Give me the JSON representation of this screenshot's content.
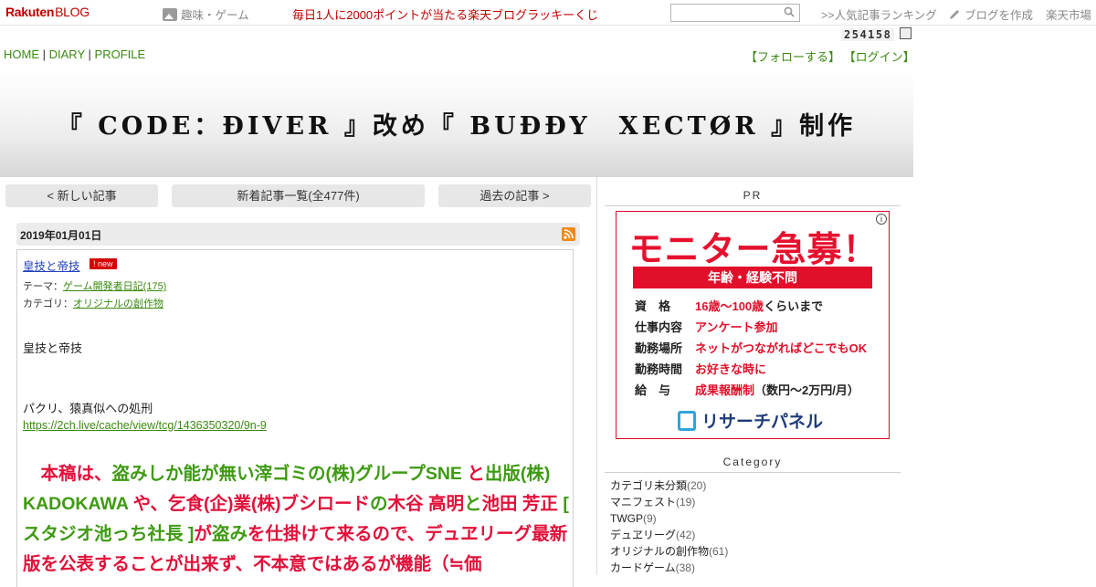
{
  "topbar": {
    "logo_main": "Rakuten",
    "logo_sub": "BLOG",
    "topic": "趣味・ゲーム",
    "lottery": "毎日1人に2000ポイントが当たる楽天ブログラッキーくじ",
    "search_placeholder": "",
    "ranking": ">>人気記事ランキング",
    "write": "ブログを作成",
    "market": "楽天市場"
  },
  "counter": "254158",
  "nav": {
    "home": "HOME",
    "sep1": "|",
    "diary": "DIARY",
    "sep2": "|",
    "profile": "PROFILE"
  },
  "follow": {
    "follow": "【フォローする】",
    "login": "【ログイン】"
  },
  "header": {
    "title": "『 CODE：ÐIVER 』改め『 BUÐÐY　XECTØR 』制作"
  },
  "pager": {
    "newer": "< 新しい記事",
    "list": "新着記事一覧(全477件)",
    "older": "過去の記事 >"
  },
  "entry": {
    "date": "2019年01月01日",
    "title": "皇技と帝技",
    "badge": "new",
    "theme_label": "テーマ：",
    "theme": "ゲーム開発者日記(175)",
    "category_label": "カテゴリ：",
    "category": "オリジナルの創作物",
    "line1": "皇技と帝技",
    "line2": "パクリ、猿真似への処刑",
    "link": "https://2ch.live/cache/view/tcg/1436350320/9n-9",
    "big": [
      {
        "t": "　本稿は、",
        "c": "r"
      },
      {
        "t": "盗みしか能が無い滓ゴミの(株)グループSNE",
        "c": "g"
      },
      {
        "t": " と",
        "c": "r"
      },
      {
        "t": "出版(株) KADOKAWA",
        "c": "g"
      },
      {
        "t": " や、",
        "c": "r"
      },
      {
        "t": "乞食(企)業(株)ブシロード",
        "c": "r"
      },
      {
        "t": "の",
        "c": "g"
      },
      {
        "t": "木谷 高明",
        "c": "r"
      },
      {
        "t": "と",
        "c": "g"
      },
      {
        "t": "池田 芳正",
        "c": "r"
      },
      {
        "t": " [ スタジオ池っち社長 ]",
        "c": "g"
      },
      {
        "t": "が",
        "c": "r"
      },
      {
        "t": "盗み",
        "c": "g"
      },
      {
        "t": "を仕掛けて来るので、デュヱリーグ最新版を公表することが出来ず、不本意ではあるが機能（≒価",
        "c": "r"
      }
    ]
  },
  "sidebar": {
    "pr_head": "PR",
    "ad": {
      "title": "モニター急募！",
      "bar": "年齢・経験不問",
      "rows": [
        {
          "k": "資　格",
          "v": "16歳〜100歳",
          "v2": "くらいまで"
        },
        {
          "k": "仕事内容",
          "v": "アンケート参加",
          "v2": ""
        },
        {
          "k": "勤務場所",
          "v": "ネットがつながればどこでもOK",
          "v2": ""
        },
        {
          "k": "勤務時間",
          "v": "お好きな時に",
          "v2": ""
        },
        {
          "k": "給　与",
          "v": "成果報酬制",
          "v2": "（数円〜2万円/月）"
        }
      ],
      "brand": "リサーチパネル"
    },
    "category_head": "Category",
    "categories": [
      {
        "name": "カテゴリ未分類",
        "count": "(20)"
      },
      {
        "name": "マニフェスト",
        "count": "(19)"
      },
      {
        "name": "TWGP",
        "count": "(9)"
      },
      {
        "name": "デュヱリーグ",
        "count": "(42)"
      },
      {
        "name": "オリジナルの創作物",
        "count": "(61)"
      },
      {
        "name": "カードゲーム",
        "count": "(38)"
      }
    ]
  }
}
